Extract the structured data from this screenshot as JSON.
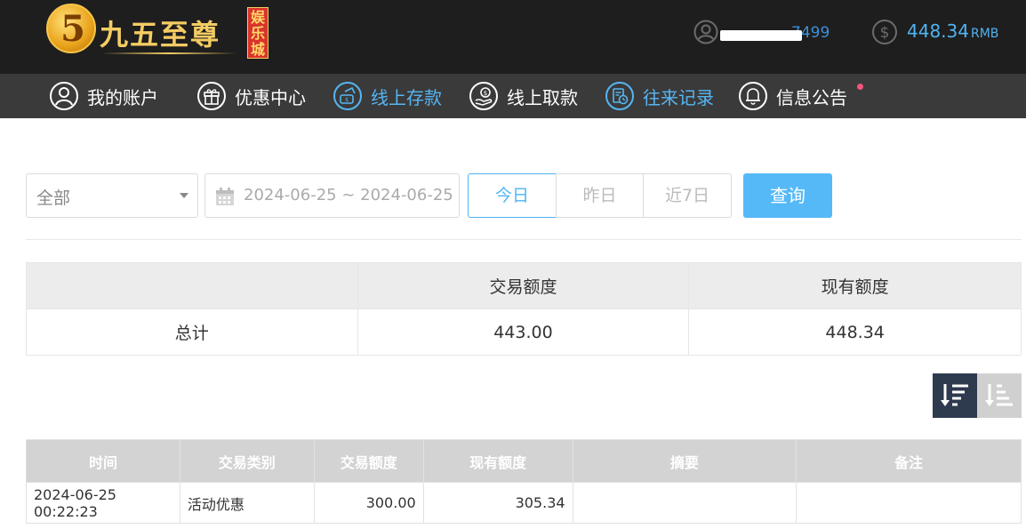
{
  "header": {
    "logo_numeral": "5",
    "logo_text": "九五至尊",
    "logo_badge": "娱乐城",
    "username_visible_tail": "7499",
    "balance_amount": "448.34",
    "balance_currency": "RMB"
  },
  "nav": [
    {
      "label": "我的账户",
      "icon": "user-circle-icon",
      "active": false
    },
    {
      "label": "优惠中心",
      "icon": "gift-icon",
      "active": false
    },
    {
      "label": "线上存款",
      "icon": "deposit-icon",
      "active": true
    },
    {
      "label": "线上取款",
      "icon": "withdraw-icon",
      "active": false
    },
    {
      "label": "往来记录",
      "icon": "records-icon",
      "active": true
    },
    {
      "label": "信息公告",
      "icon": "bell-icon",
      "active": false
    }
  ],
  "filters": {
    "type_select": "全部",
    "date_range": "2024-06-25 ~ 2024-06-25",
    "seg_today": "今日",
    "seg_yesterday": "昨日",
    "seg_7days": "近7日",
    "query_button": "查询"
  },
  "summary": {
    "headers": [
      "",
      "交易额度",
      "现有额度"
    ],
    "row_label": "总计",
    "trade_total": "443.00",
    "current_total": "448.34"
  },
  "detail": {
    "headers": [
      "时间",
      "交易类别",
      "交易额度",
      "现有额度",
      "摘要",
      "备注"
    ],
    "rows": [
      {
        "time": "2024-06-25 00:22:23",
        "category": "活动优惠",
        "amount": "300.00",
        "balance": "305.34",
        "summary": "",
        "note": ""
      }
    ]
  },
  "colors": {
    "accent": "#4fb4f2",
    "topbar": "#1e1e1e",
    "navbar": "#3a3a3a",
    "notify_dot": "#f5547a"
  }
}
